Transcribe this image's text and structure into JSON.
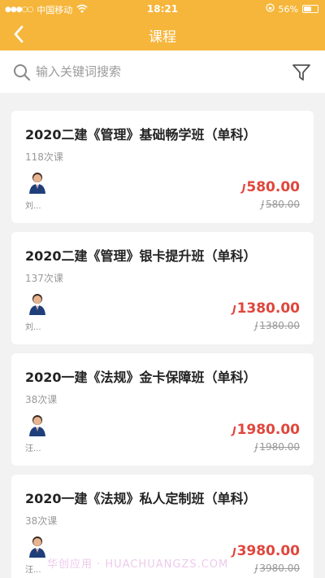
{
  "status_bar": {
    "carrier": "中国移动",
    "time": "18:21",
    "battery": "56%",
    "battery_level": 0.56
  },
  "header": {
    "title": "课程"
  },
  "search": {
    "placeholder": "输入关键词搜索"
  },
  "currency_symbol": "J",
  "courses": [
    {
      "title": "2020二建《管理》基础畅学班（单科）",
      "lessons": "118次课",
      "teacher": "刘...",
      "price": "580.00",
      "original_price": "580.00"
    },
    {
      "title": "2020二建《管理》银卡提升班（单科）",
      "lessons": "137次课",
      "teacher": "刘...",
      "price": "1380.00",
      "original_price": "1380.00"
    },
    {
      "title": "2020一建《法规》金卡保障班（单科）",
      "lessons": "38次课",
      "teacher": "汪...",
      "price": "1980.00",
      "original_price": "1980.00"
    },
    {
      "title": "2020一建《法规》私人定制班（单科）",
      "lessons": "38次课",
      "teacher": "汪...",
      "price": "3980.00",
      "original_price": "3980.00"
    }
  ],
  "watermark": "华创应用 · HUACHUANGZS.COM",
  "colors": {
    "header_bg": "#f6b63b",
    "price": "#e0463c"
  }
}
